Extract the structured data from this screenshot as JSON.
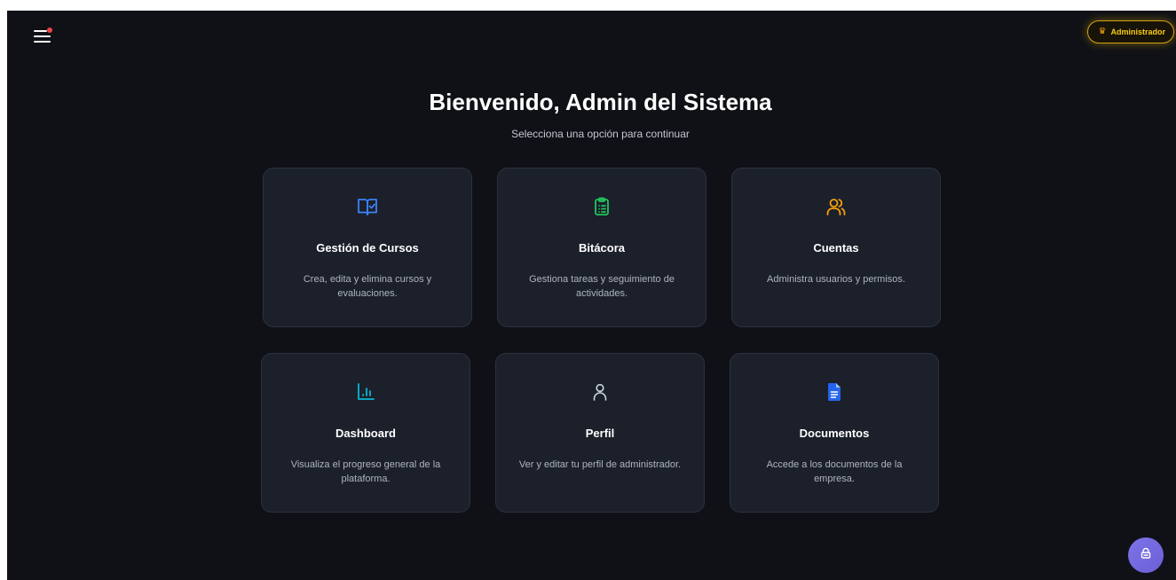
{
  "header": {
    "menu_icon": "hamburger-icon",
    "notification_color": "#ef4444",
    "role_badge": {
      "icon": "crown-icon",
      "label": "Administrador",
      "color": "#facc15"
    }
  },
  "welcome": {
    "title": "Bienvenido, Admin del Sistema",
    "subtitle": "Selecciona una opción para continuar"
  },
  "cards": [
    {
      "title": "Gestión de Cursos",
      "description": "Crea, edita y elimina cursos y evaluaciones.",
      "icon": "book-check-icon",
      "color": "#3b82f6"
    },
    {
      "title": "Bitácora",
      "description": "Gestiona tareas y seguimiento de actividades.",
      "icon": "clipboard-list-icon",
      "color": "#22c55e"
    },
    {
      "title": "Cuentas",
      "description": "Administra usuarios y permisos.",
      "icon": "users-icon",
      "color": "#f59e0b"
    },
    {
      "title": "Dashboard",
      "description": "Visualiza el progreso general de la plataforma.",
      "icon": "bar-chart-icon",
      "color": "#06b6d4"
    },
    {
      "title": "Perfil",
      "description": "Ver y editar tu perfil de administrador.",
      "icon": "user-icon",
      "color": "#cbd5e1"
    },
    {
      "title": "Documentos",
      "description": "Accede a los documentos de la empresa.",
      "icon": "document-icon",
      "color": "#2563eb"
    }
  ],
  "floating_action": {
    "icon": "chat-bot-icon",
    "color": "#7c74e8"
  }
}
